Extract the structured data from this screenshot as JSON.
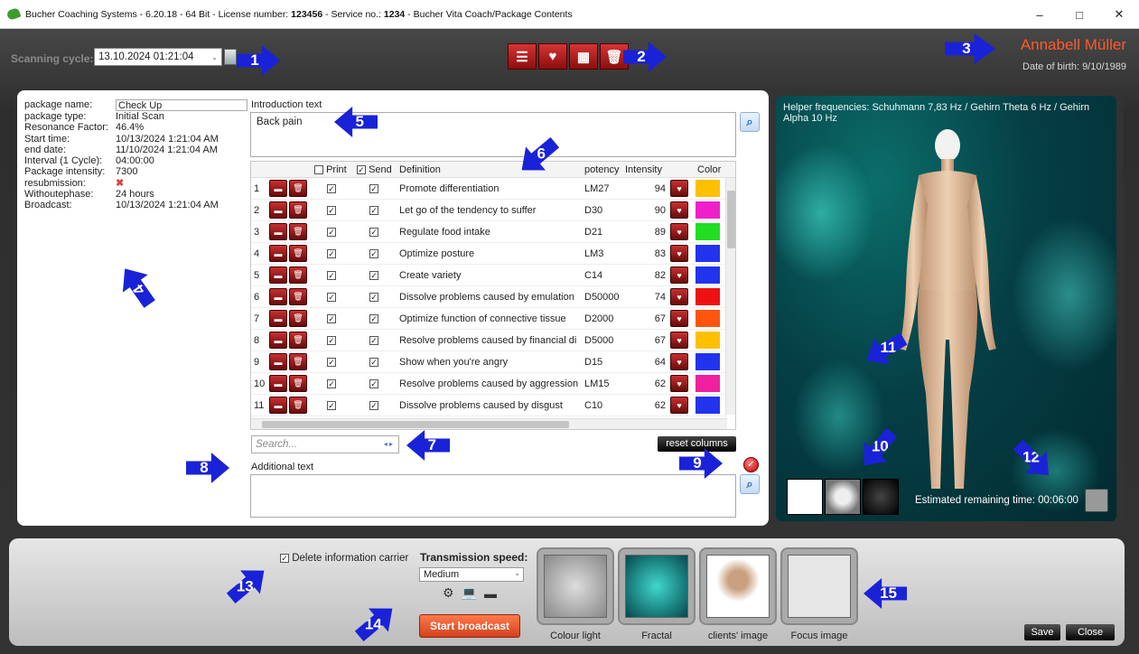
{
  "window": {
    "app_name": "Bucher Coaching Systems - 6.20.18 - 64 Bit - License number: ",
    "license": "123456",
    "service_prefix": " - Service no.: ",
    "service": "1234",
    "path": " - Bucher Vita Coach/Package Contents",
    "min": "–",
    "max": "□",
    "close": "✕"
  },
  "header": {
    "scan_label": "Scanning cycle:",
    "scan_value": "13.10.2024 01:21:04",
    "person_name": "Annabell Müller",
    "dob": "Date of birth: 9/10/1989"
  },
  "toolbar": {
    "icons": [
      "report-add-icon",
      "heart-export-icon",
      "grid-icon",
      "trash-icon"
    ]
  },
  "info": {
    "rows": [
      {
        "k": "package name:",
        "v": "Check Up"
      },
      {
        "k": "package type:",
        "v": "Initial Scan"
      },
      {
        "k": "Resonance Factor:",
        "v": "46.4%"
      },
      {
        "k": "Start time:",
        "v": "10/13/2024 1:21:04 AM"
      },
      {
        "k": "end date:",
        "v": "11/10/2024 1:21:04 AM"
      },
      {
        "k": "Interval (1 Cycle):",
        "v": "04:00:00"
      },
      {
        "k": "Package intensity:",
        "v": "7300"
      },
      {
        "k": "resubmission:",
        "v": "✖"
      },
      {
        "k": "Withoutephase:",
        "v": "24 hours"
      },
      {
        "k": "Broadcast:",
        "v": "10/13/2024 1:21:04 AM"
      }
    ]
  },
  "intro": {
    "label": "Introduction text",
    "value": "Back pain"
  },
  "table": {
    "headers": {
      "print": "Print",
      "send": "Send",
      "definition": "Definition",
      "potency": "potency",
      "intensity": "Intensity",
      "color": "Color"
    },
    "rows": [
      {
        "n": "1",
        "def": "Promote differentiation",
        "pot": "LM27",
        "int": "94",
        "color": "#ffc000"
      },
      {
        "n": "2",
        "def": "Let go of the tendency to suffer",
        "pot": "D30",
        "int": "90",
        "color": "#f020c8"
      },
      {
        "n": "3",
        "def": "Regulate food intake",
        "pot": "D21",
        "int": "89",
        "color": "#22dd22"
      },
      {
        "n": "4",
        "def": "Optimize posture",
        "pot": "LM3",
        "int": "83",
        "color": "#2233ee"
      },
      {
        "n": "5",
        "def": "Create variety",
        "pot": "C14",
        "int": "82",
        "color": "#2233ee"
      },
      {
        "n": "6",
        "def": "Dissolve problems caused by emulation",
        "pot": "D50000",
        "int": "74",
        "color": "#ee1111"
      },
      {
        "n": "7",
        "def": "Optimize function of connective tissue",
        "pot": "D2000",
        "int": "67",
        "color": "#ff5511"
      },
      {
        "n": "8",
        "def": "Resolve problems caused by financial di",
        "pot": "D5000",
        "int": "67",
        "color": "#ffc000"
      },
      {
        "n": "9",
        "def": "Show when you're angry",
        "pot": "D15",
        "int": "64",
        "color": "#2233ee"
      },
      {
        "n": "10",
        "def": "Resolve problems caused by aggression",
        "pot": "LM15",
        "int": "62",
        "color": "#f020a0"
      },
      {
        "n": "11",
        "def": "Dissolve problems caused by disgust",
        "pot": "C10",
        "int": "62",
        "color": "#2233ee"
      }
    ]
  },
  "search": {
    "placeholder": "Search..."
  },
  "reset_columns": "reset columns",
  "additional": {
    "label": "Additional text"
  },
  "viewer": {
    "helper": "Helper frequencies: Schuhmann 7,83 Hz / Gehirn Theta 6 Hz / Gehirn Alpha 10 Hz",
    "eta": "Estimated remaining time: 00:06:00"
  },
  "bottom": {
    "delete_label": "Delete information carrier",
    "speed_label": "Transmission speed:",
    "speed_value": "Medium",
    "start": "Start broadcast",
    "tiles": [
      "Colour light",
      "Fractal",
      "clients' image",
      "Focus image"
    ],
    "save": "Save",
    "close": "Close"
  },
  "markers": [
    "1",
    "2",
    "3",
    "4",
    "5",
    "6",
    "7",
    "8",
    "9",
    "10",
    "11",
    "12",
    "13",
    "14",
    "15"
  ]
}
